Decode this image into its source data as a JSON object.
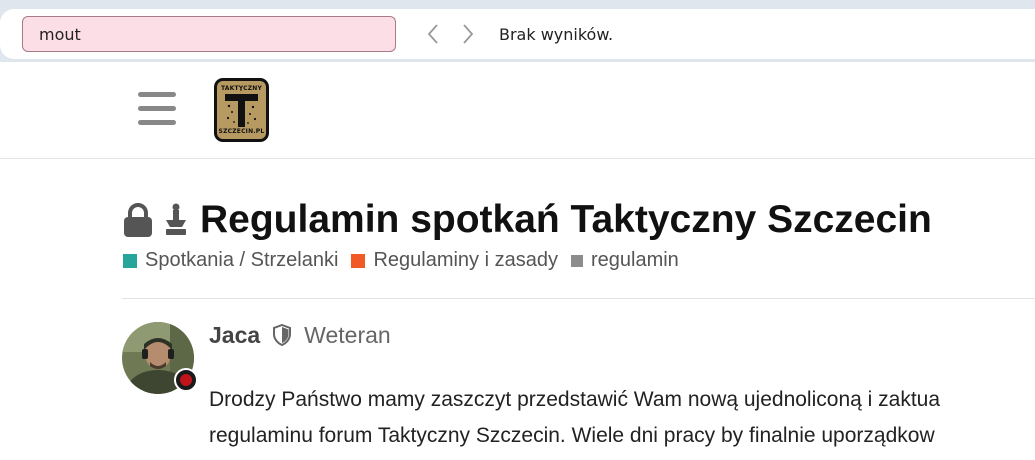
{
  "findbar": {
    "query": "mout",
    "status": "Brak wyników."
  },
  "header": {
    "logo_line1": "TAKTYCZNY",
    "logo_line2": "SZCZECIN.PL"
  },
  "topic": {
    "title": "Regulamin spotkań Taktyczny Szczecin",
    "categories": [
      {
        "label": "Spotkania / Strzelanki",
        "color": "#26a69a"
      },
      {
        "label": "Regulaminy i zasady",
        "color": "#f15a24"
      }
    ],
    "tag": {
      "label": "regulamin",
      "color": "#8c8c8c"
    }
  },
  "post": {
    "username": "Jaca",
    "user_title": "Weteran",
    "lines": [
      "Drodzy Państwo mamy zaszczyt przedstawić Wam nową ujednoliconą i zaktua",
      "regulaminu forum Taktyczny Szczecin. Wiele dni pracy by finalnie uporządkow"
    ]
  },
  "colors": {
    "find_highlight": "#fcdfe6",
    "text_dark": "#111111",
    "muted": "#666666"
  }
}
